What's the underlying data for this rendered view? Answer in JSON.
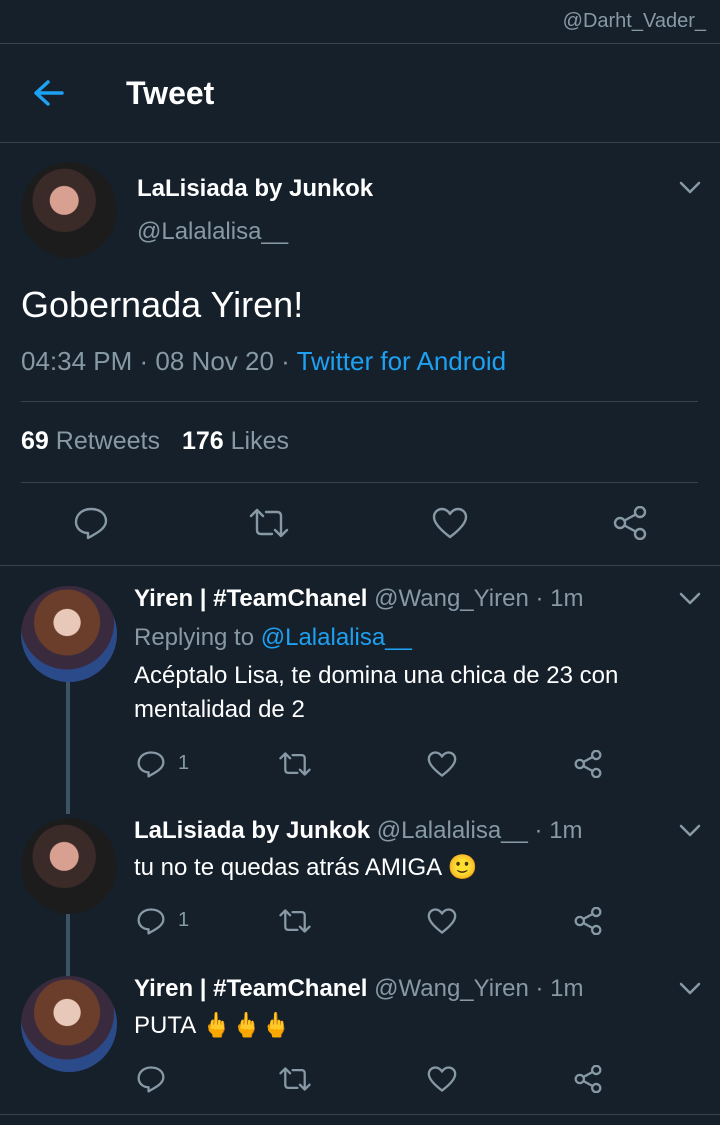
{
  "watermark": "@Darht_Vader_",
  "header": {
    "title": "Tweet"
  },
  "main_tweet": {
    "name": "LaLisiada by Junkok",
    "handle": "@Lalalalisa__",
    "text": "Gobernada Yiren!",
    "time": "04:34 PM · 08 Nov 20 · ",
    "source": "Twitter for Android",
    "retweets_count": "69",
    "retweets_label": "Retweets",
    "likes_count": "176",
    "likes_label": "Likes"
  },
  "replies": [
    {
      "name": "Yiren | #TeamChanel",
      "handle": "@Wang_Yiren · 1m",
      "replying_prefix": "Replying to ",
      "replying_to": "@Lalalalisa__",
      "text": "Acéptalo Lisa, te domina una chica de 23 con mentalidad de 2",
      "reply_count": "1"
    },
    {
      "name": "LaLisiada by Junkok",
      "handle": "@Lalalalisa__ · 1m",
      "text": "tu no te quedas atrás AMIGA 🙂",
      "reply_count": "1"
    },
    {
      "name": "Yiren | #TeamChanel",
      "handle": "@Wang_Yiren · 1m",
      "text": "PUTA 🖕🖕🖕"
    }
  ],
  "icons": {
    "back": "arrow-left-icon",
    "chevron": "chevron-down-icon",
    "reply": "reply-icon",
    "retweet": "retweet-icon",
    "like": "heart-icon",
    "share": "share-icon"
  },
  "colors": {
    "background": "#15202b",
    "accent": "#1da1f2",
    "muted": "#8899a6",
    "divider": "#38444d"
  }
}
